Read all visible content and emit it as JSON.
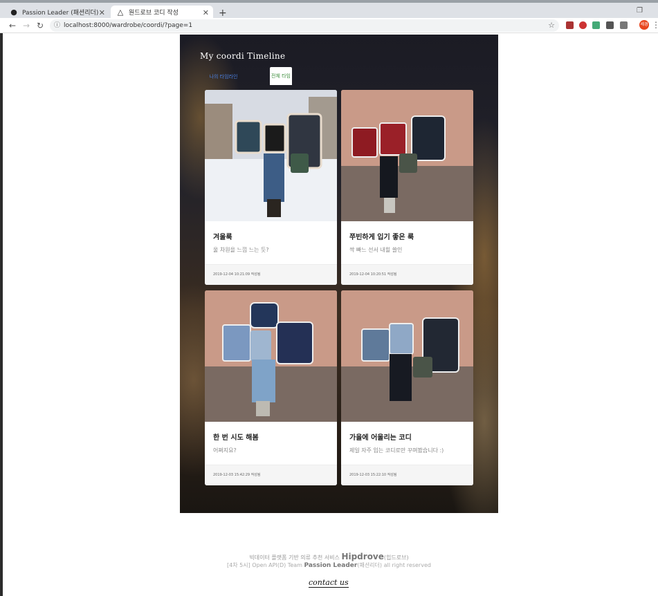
{
  "browser": {
    "tabs": [
      {
        "label": "Passion Leader (패션리더)",
        "icon": "github-icon"
      },
      {
        "label": "원드로브 코디 작성",
        "icon": "hanger-icon",
        "active": true
      }
    ],
    "new_tab": "+",
    "url": "localhost:8000/wardrobe/coordi/?page=1",
    "profile_initial": "세경"
  },
  "page": {
    "title": "My coordi Timeline",
    "tab_mine": "나의 타임라인",
    "tab_other": "전체 타임라인",
    "cards": [
      {
        "title": "겨울룩",
        "subtitle": "울 차원을 느낌 느는 듯?",
        "footer": "2019-12-04 10:21:09 작성됨"
      },
      {
        "title": "쭈빈하게 입기 좋은 룩",
        "subtitle": "싹 빠느 선서 내힐 쓸인",
        "footer": "2019-12-04 10:20:51 작성됨"
      },
      {
        "title": "한 번 시도 해봄",
        "subtitle": "어쩌지요?",
        "footer": "2019-12-03 15:42:29 작성됨"
      },
      {
        "title": "가을에 어울리는 코디",
        "subtitle": "제일 자주 입는 코디로만 꾸며봤습니다 :)",
        "footer": "2019-12-03 15:22:10 작성됨"
      }
    ],
    "footer": {
      "line1_prefix": "빅데이터 플랫폼 기반 의류 추천 서비스",
      "brand1": "Hipdrove",
      "line1_suffix": "(힙드로브)",
      "line2_prefix": "[4차 5시] Open API(D) Team",
      "brand2": "Passion Leader",
      "line2_suffix": "(패션리더) all right reserved",
      "contact": "contact us"
    }
  }
}
